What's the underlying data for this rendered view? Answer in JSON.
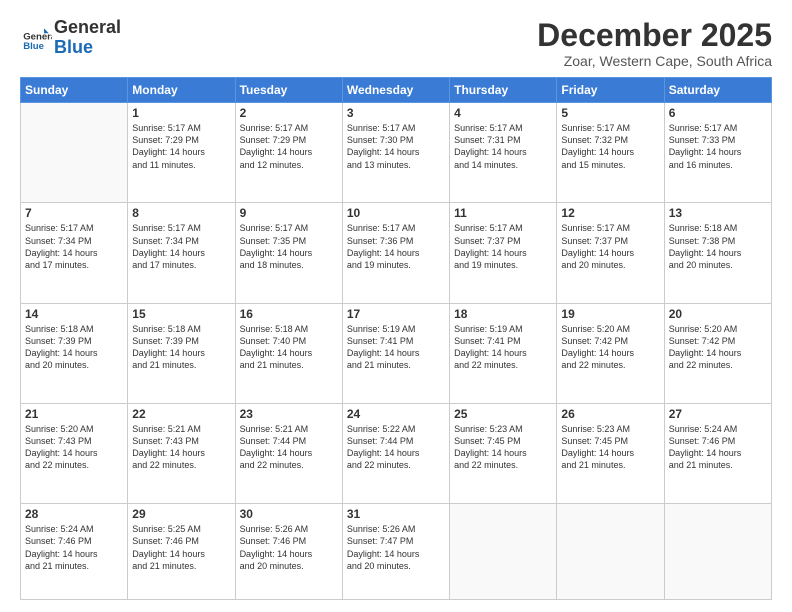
{
  "logo": {
    "line1": "General",
    "line2": "Blue"
  },
  "title": "December 2025",
  "subtitle": "Zoar, Western Cape, South Africa",
  "weekdays": [
    "Sunday",
    "Monday",
    "Tuesday",
    "Wednesday",
    "Thursday",
    "Friday",
    "Saturday"
  ],
  "weeks": [
    [
      {
        "day": "",
        "info": ""
      },
      {
        "day": "1",
        "info": "Sunrise: 5:17 AM\nSunset: 7:29 PM\nDaylight: 14 hours\nand 11 minutes."
      },
      {
        "day": "2",
        "info": "Sunrise: 5:17 AM\nSunset: 7:29 PM\nDaylight: 14 hours\nand 12 minutes."
      },
      {
        "day": "3",
        "info": "Sunrise: 5:17 AM\nSunset: 7:30 PM\nDaylight: 14 hours\nand 13 minutes."
      },
      {
        "day": "4",
        "info": "Sunrise: 5:17 AM\nSunset: 7:31 PM\nDaylight: 14 hours\nand 14 minutes."
      },
      {
        "day": "5",
        "info": "Sunrise: 5:17 AM\nSunset: 7:32 PM\nDaylight: 14 hours\nand 15 minutes."
      },
      {
        "day": "6",
        "info": "Sunrise: 5:17 AM\nSunset: 7:33 PM\nDaylight: 14 hours\nand 16 minutes."
      }
    ],
    [
      {
        "day": "7",
        "info": "Sunrise: 5:17 AM\nSunset: 7:34 PM\nDaylight: 14 hours\nand 17 minutes."
      },
      {
        "day": "8",
        "info": "Sunrise: 5:17 AM\nSunset: 7:34 PM\nDaylight: 14 hours\nand 17 minutes."
      },
      {
        "day": "9",
        "info": "Sunrise: 5:17 AM\nSunset: 7:35 PM\nDaylight: 14 hours\nand 18 minutes."
      },
      {
        "day": "10",
        "info": "Sunrise: 5:17 AM\nSunset: 7:36 PM\nDaylight: 14 hours\nand 19 minutes."
      },
      {
        "day": "11",
        "info": "Sunrise: 5:17 AM\nSunset: 7:37 PM\nDaylight: 14 hours\nand 19 minutes."
      },
      {
        "day": "12",
        "info": "Sunrise: 5:17 AM\nSunset: 7:37 PM\nDaylight: 14 hours\nand 20 minutes."
      },
      {
        "day": "13",
        "info": "Sunrise: 5:18 AM\nSunset: 7:38 PM\nDaylight: 14 hours\nand 20 minutes."
      }
    ],
    [
      {
        "day": "14",
        "info": "Sunrise: 5:18 AM\nSunset: 7:39 PM\nDaylight: 14 hours\nand 20 minutes."
      },
      {
        "day": "15",
        "info": "Sunrise: 5:18 AM\nSunset: 7:39 PM\nDaylight: 14 hours\nand 21 minutes."
      },
      {
        "day": "16",
        "info": "Sunrise: 5:18 AM\nSunset: 7:40 PM\nDaylight: 14 hours\nand 21 minutes."
      },
      {
        "day": "17",
        "info": "Sunrise: 5:19 AM\nSunset: 7:41 PM\nDaylight: 14 hours\nand 21 minutes."
      },
      {
        "day": "18",
        "info": "Sunrise: 5:19 AM\nSunset: 7:41 PM\nDaylight: 14 hours\nand 22 minutes."
      },
      {
        "day": "19",
        "info": "Sunrise: 5:20 AM\nSunset: 7:42 PM\nDaylight: 14 hours\nand 22 minutes."
      },
      {
        "day": "20",
        "info": "Sunrise: 5:20 AM\nSunset: 7:42 PM\nDaylight: 14 hours\nand 22 minutes."
      }
    ],
    [
      {
        "day": "21",
        "info": "Sunrise: 5:20 AM\nSunset: 7:43 PM\nDaylight: 14 hours\nand 22 minutes."
      },
      {
        "day": "22",
        "info": "Sunrise: 5:21 AM\nSunset: 7:43 PM\nDaylight: 14 hours\nand 22 minutes."
      },
      {
        "day": "23",
        "info": "Sunrise: 5:21 AM\nSunset: 7:44 PM\nDaylight: 14 hours\nand 22 minutes."
      },
      {
        "day": "24",
        "info": "Sunrise: 5:22 AM\nSunset: 7:44 PM\nDaylight: 14 hours\nand 22 minutes."
      },
      {
        "day": "25",
        "info": "Sunrise: 5:23 AM\nSunset: 7:45 PM\nDaylight: 14 hours\nand 22 minutes."
      },
      {
        "day": "26",
        "info": "Sunrise: 5:23 AM\nSunset: 7:45 PM\nDaylight: 14 hours\nand 21 minutes."
      },
      {
        "day": "27",
        "info": "Sunrise: 5:24 AM\nSunset: 7:46 PM\nDaylight: 14 hours\nand 21 minutes."
      }
    ],
    [
      {
        "day": "28",
        "info": "Sunrise: 5:24 AM\nSunset: 7:46 PM\nDaylight: 14 hours\nand 21 minutes."
      },
      {
        "day": "29",
        "info": "Sunrise: 5:25 AM\nSunset: 7:46 PM\nDaylight: 14 hours\nand 21 minutes."
      },
      {
        "day": "30",
        "info": "Sunrise: 5:26 AM\nSunset: 7:46 PM\nDaylight: 14 hours\nand 20 minutes."
      },
      {
        "day": "31",
        "info": "Sunrise: 5:26 AM\nSunset: 7:47 PM\nDaylight: 14 hours\nand 20 minutes."
      },
      {
        "day": "",
        "info": ""
      },
      {
        "day": "",
        "info": ""
      },
      {
        "day": "",
        "info": ""
      }
    ]
  ]
}
